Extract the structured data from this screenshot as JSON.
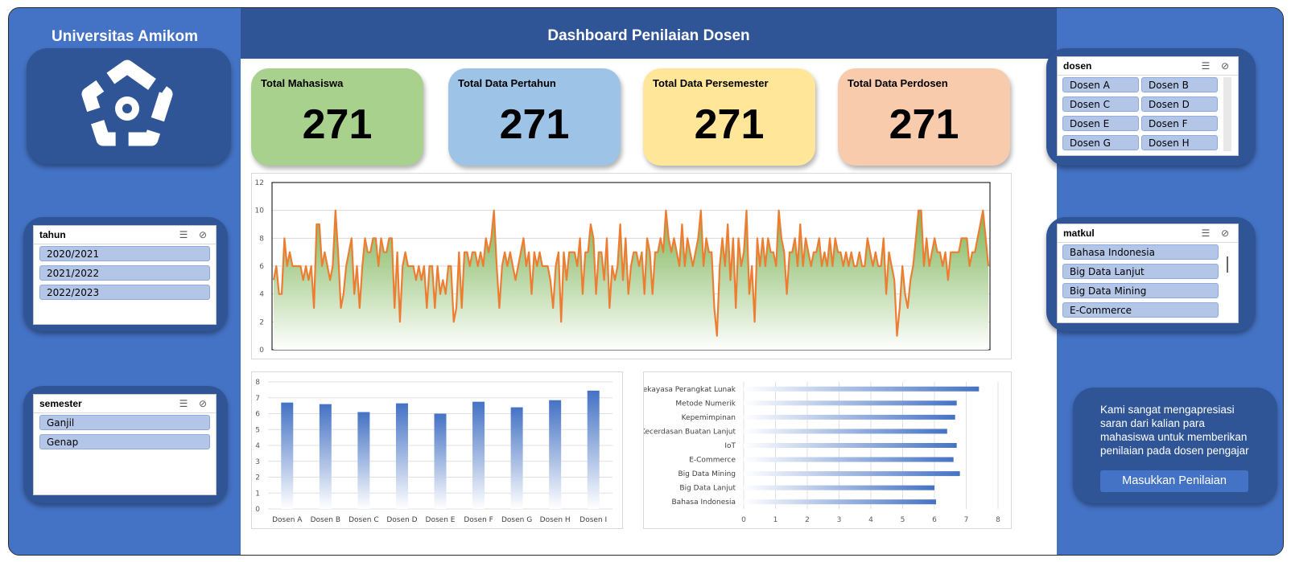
{
  "app": {
    "university": "Universitas Amikom",
    "dashboard_title": "Dashboard Penilaian Dosen"
  },
  "kpis": [
    {
      "label": "Total Mahasiswa",
      "value": "271",
      "color": "#a9d18e"
    },
    {
      "label": "Total Data Pertahun",
      "value": "271",
      "color": "#9dc3e6"
    },
    {
      "label": "Total Data Persemester",
      "value": "271",
      "color": "#ffe699"
    },
    {
      "label": "Total Data Perdosen",
      "value": "271",
      "color": "#f8cbad"
    }
  ],
  "slicers": {
    "tahun": {
      "title": "tahun",
      "items": [
        "2020/2021",
        "2021/2022",
        "2022/2023"
      ]
    },
    "semester": {
      "title": "semester",
      "items": [
        "Ganjil",
        "Genap"
      ]
    },
    "dosen": {
      "title": "dosen",
      "items": [
        "Dosen A",
        "Dosen B",
        "Dosen C",
        "Dosen D",
        "Dosen E",
        "Dosen F",
        "Dosen G",
        "Dosen H"
      ]
    },
    "matkul": {
      "title": "matkul",
      "items": [
        "Bahasa Indonesia",
        "Big Data Lanjut",
        "Big Data Mining",
        "E-Commerce"
      ]
    }
  },
  "icons": {
    "multi_select": "multi-select-icon",
    "clear_filter": "clear-filter-icon",
    "logo": "amikom-logo"
  },
  "message": {
    "text": "Kami sangat mengapresiasi saran dari kalian para mahasiswa untuk memberikan penilaian pada dosen pengajar",
    "button_label": "Masukkan Penilaian"
  },
  "colors": {
    "panel_blue": "#4472c4",
    "dark_blue": "#2f5597",
    "slicer_item": "#b4c6e7",
    "line": "#ed7d31",
    "area": "#70ad47",
    "bar": "#4472c4"
  },
  "chart_data": [
    {
      "type": "area",
      "ylim": [
        0,
        12
      ],
      "yticks": [
        "0",
        "2",
        "4",
        "6",
        "8",
        "10",
        "12"
      ],
      "values": [
        5,
        6,
        4,
        4,
        8,
        6,
        7,
        6,
        6,
        6,
        6,
        5,
        6,
        5,
        6,
        3,
        9,
        9,
        6,
        7,
        6,
        5,
        6,
        10,
        7,
        3,
        4,
        6,
        7,
        8,
        4,
        6,
        3,
        6,
        8,
        7,
        7,
        8,
        8,
        6,
        8,
        7,
        7,
        8,
        8,
        3,
        7,
        2,
        6,
        7,
        6,
        6,
        6,
        5,
        6,
        5,
        6,
        3,
        6,
        6,
        3,
        6,
        4,
        5,
        4,
        6,
        6,
        2,
        3,
        7,
        3,
        7,
        7,
        6,
        7,
        7,
        6,
        7,
        6,
        8,
        7,
        8,
        10,
        6,
        3,
        6,
        7,
        6,
        7,
        6,
        5,
        6,
        7,
        8,
        6,
        7,
        4,
        7,
        6,
        7,
        6,
        6,
        6,
        5,
        3,
        6,
        7,
        2,
        7,
        5,
        7,
        7,
        7,
        6,
        8,
        4,
        7,
        7,
        9,
        8,
        4,
        7,
        7,
        5,
        8,
        3,
        6,
        5,
        6,
        9,
        5,
        8,
        4,
        6,
        7,
        7,
        6,
        7,
        4,
        8,
        7,
        4,
        7,
        7,
        8,
        7,
        10,
        8,
        7,
        8,
        7,
        6,
        9,
        6,
        8,
        7,
        6,
        7,
        8,
        10,
        6,
        8,
        7,
        7,
        3,
        1,
        6,
        8,
        6,
        9,
        5,
        8,
        3,
        8,
        6,
        7,
        10,
        4,
        6,
        2,
        8,
        6,
        8,
        6,
        8,
        7,
        7,
        6,
        10,
        8,
        7,
        4,
        7,
        7,
        8,
        6,
        9,
        6,
        8,
        7,
        6,
        7,
        7,
        8,
        6,
        7,
        6,
        8,
        6,
        8,
        7,
        7,
        6,
        7,
        6,
        7,
        6,
        6,
        7,
        6,
        6,
        8,
        7,
        6,
        7,
        6,
        6,
        8,
        4,
        7,
        6,
        5,
        1,
        3,
        6,
        4,
        3,
        5,
        6,
        8,
        10,
        10,
        6,
        8,
        6,
        7,
        8,
        7,
        7,
        6,
        7,
        5,
        7,
        7,
        7,
        7,
        8,
        8,
        8,
        6,
        7,
        7,
        8,
        9,
        10,
        8,
        6
      ]
    },
    {
      "type": "bar",
      "categories": [
        "Dosen A",
        "Dosen B",
        "Dosen C",
        "Dosen D",
        "Dosen E",
        "Dosen F",
        "Dosen G",
        "Dosen H",
        "Dosen I"
      ],
      "values": [
        6.7,
        6.6,
        6.1,
        6.65,
        6.0,
        6.75,
        6.4,
        6.85,
        7.45
      ],
      "ylim": [
        0,
        8
      ],
      "yticks": [
        "0",
        "1",
        "2",
        "3",
        "4",
        "5",
        "6",
        "7",
        "8"
      ]
    },
    {
      "type": "bar",
      "orientation": "horizontal",
      "categories": [
        "Rekayasa Perangkat Lunak",
        "Metode Numerik",
        "Kepemimpinan",
        "Kecerdasan Buatan Lanjut",
        "IoT",
        "E-Commerce",
        "Big Data Mining",
        "Big Data Lanjut",
        "Bahasa Indonesia"
      ],
      "values": [
        7.4,
        6.7,
        6.65,
        6.4,
        6.7,
        6.6,
        6.8,
        6.0,
        6.05
      ],
      "xlim": [
        0,
        8
      ],
      "xticks": [
        "0",
        "1",
        "2",
        "3",
        "4",
        "5",
        "6",
        "7",
        "8"
      ]
    }
  ]
}
